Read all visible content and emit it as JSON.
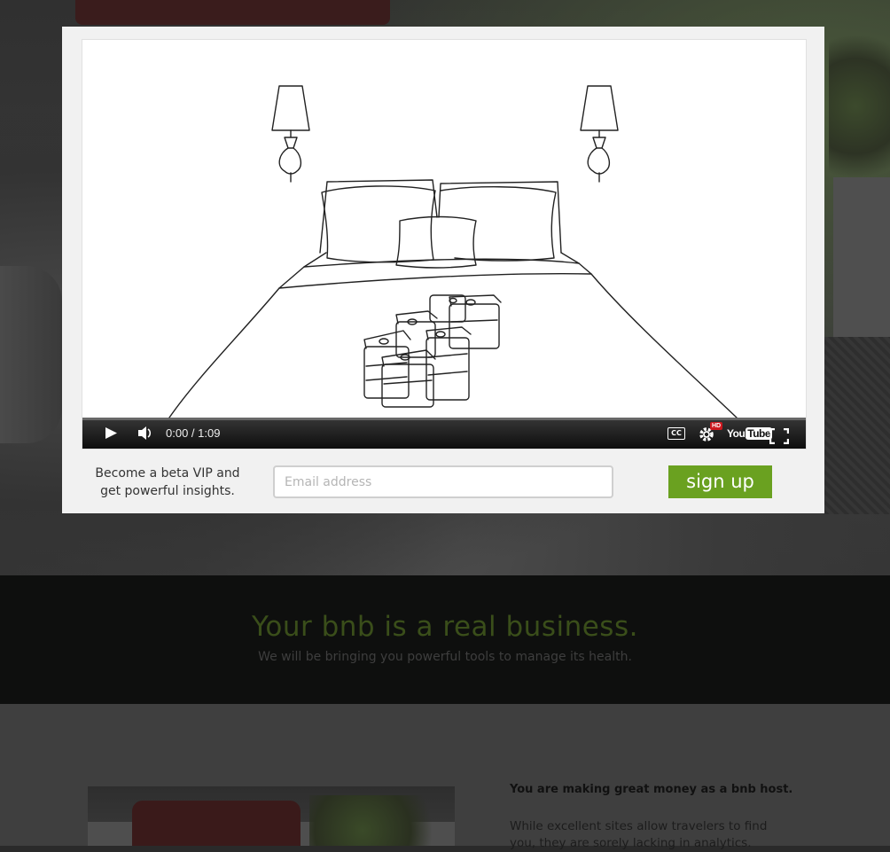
{
  "video": {
    "time_current": "0:00",
    "time_separator": " / ",
    "time_total": "1:09",
    "cc_label": "CC",
    "hd_badge": "HD",
    "logo_you": "You",
    "logo_tube": "Tube",
    "icons": [
      "play-icon",
      "volume-icon",
      "cc-icon",
      "settings-gear-icon",
      "youtube-logo",
      "fullscreen-icon"
    ]
  },
  "signup": {
    "cta_line1": "Become a beta VIP and",
    "cta_line2": "get powerful insights.",
    "email_placeholder": "Email address",
    "button_label": "sign up",
    "button_color": "#6aa120"
  },
  "band": {
    "headline": "Your bnb is a real business.",
    "subhead": "We will be bringing you powerful tools to manage its health."
  },
  "section": {
    "heading": "You are making great money as a bnb host.",
    "body": "While excellent sites allow travelers to find you, they are sorely lacking in analytics."
  }
}
